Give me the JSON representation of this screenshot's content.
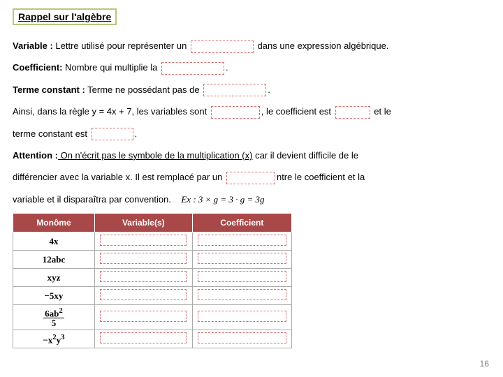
{
  "header": {
    "title": "Rappel sur l'algèbre"
  },
  "defs": {
    "variable_label": "Variable :",
    "variable_text1": " Lettre utilisé pour représenter un ",
    "variable_text2": " dans une expression algébrique.",
    "coeff_label": "Coefficient:",
    "coeff_text": " Nombre qui multiplie la ",
    "const_label": "Terme constant :",
    "const_text": " Terme ne possédant pas de ",
    "example_text1": "Ainsi, dans la règle y = 4x + 7, les variables sont ",
    "example_text2": ", le coefficient est ",
    "example_text3": " et le",
    "example_text4": "terme constant est ",
    "attention_label": "Attention :",
    "attention_text1": " On n'écrit pas le symbole de la multiplication (x)",
    "attention_text2": " car il devient difficile de le",
    "attention_line2a": "différencier avec la variable x. Il est remplacé par un ",
    "attention_line2b": "ntre le coefficient et la",
    "attention_line3": "variable et il disparaîtra par convention.",
    "math_example": "Ex : 3 × g = 3 · g = 3g"
  },
  "table": {
    "headers": [
      "Monôme",
      "Variable(s)",
      "Coefficient"
    ],
    "monomes": [
      "4x",
      "12abc",
      "xyz",
      "−5xy",
      "frac:6ab²|5",
      "−x²y³"
    ]
  },
  "page_number": "16"
}
